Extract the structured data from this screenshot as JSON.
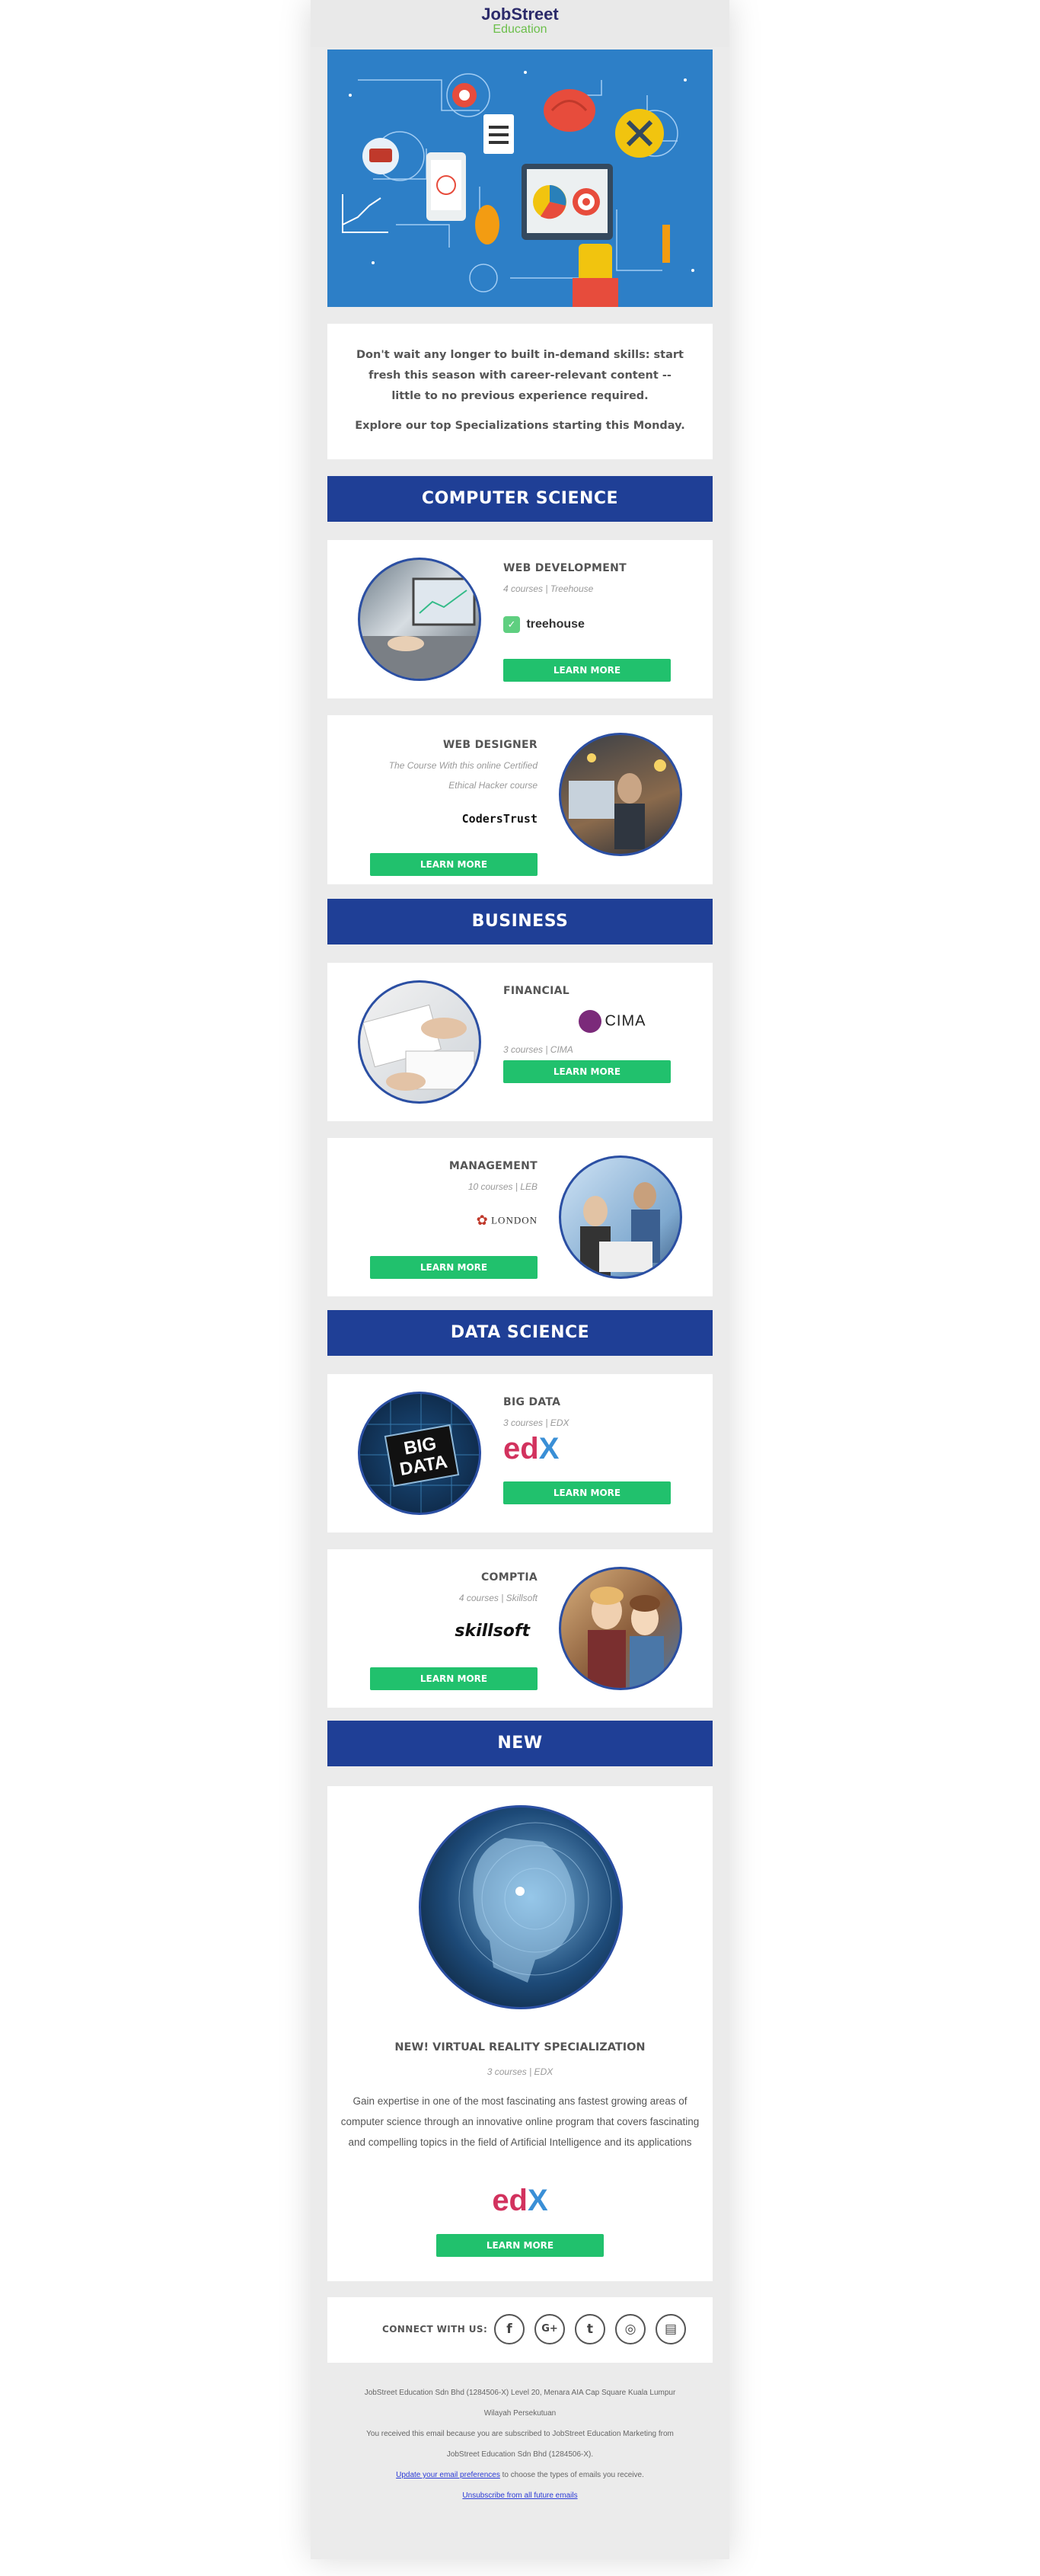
{
  "brand": {
    "logo_top": "JobStreet",
    "logo_bottom": "Education"
  },
  "intro": {
    "text": "Don't wait any longer to built in-demand skills: start fresh this season with career-relevant content -- little to no previous experience required.",
    "sub": "Explore our top Specializations starting this Monday."
  },
  "sections": {
    "cs": "COMPUTER SCIENCE",
    "business": "BUSINESS",
    "ds": "DATA SCIENCE",
    "new": "NEW"
  },
  "cards": {
    "webdev": {
      "title": "WEB DEVELOPMENT",
      "meta": "4 courses | Treehouse",
      "brand": "treehouse",
      "button": "LEARN MORE"
    },
    "webdesigner": {
      "title": "WEB DESIGNER",
      "meta_line1": "The Course With this online Certified",
      "meta_line2": "Ethical Hacker course",
      "brand": "CodersTrust",
      "button": "LEARN MORE"
    },
    "financial": {
      "title": "FINANCIAL",
      "meta": "3 courses | CIMA",
      "brand": "CIMA",
      "button": "LEARN MORE"
    },
    "management": {
      "title": "MANAGEMENT",
      "meta": "10 courses | LEB",
      "brand": "LONDON",
      "button": "LEARN MORE"
    },
    "bigdata": {
      "title": "BIG DATA",
      "meta": "3 courses | EDX",
      "brand_a": "ed",
      "brand_b": "X",
      "button": "LEARN MORE",
      "image_text_1": "BIG",
      "image_text_2": "DATA"
    },
    "comptia": {
      "title": "COMPTIA",
      "meta": "4 courses | Skillsoft",
      "brand": "skillsoft",
      "button": "LEARN MORE"
    }
  },
  "new_card": {
    "title": "NEW! VIRTUAL REALITY SPECIALIZATION",
    "meta": "3 courses | EDX",
    "description": "Gain expertise in one of the most fascinating ans fastest growing areas of computer science through an innovative online program that covers fascinating and compelling topics in the field of Artificial Intelligence and its applications",
    "brand_a": "ed",
    "brand_b": "X",
    "button": "LEARN MORE"
  },
  "footer": {
    "connect_label": "CONNECT WITH US:",
    "social": [
      {
        "name": "facebook-icon",
        "glyph": "f"
      },
      {
        "name": "google-plus-icon",
        "glyph": "G+"
      },
      {
        "name": "twitter-icon",
        "glyph": "t"
      },
      {
        "name": "instagram-icon",
        "glyph": "◎"
      },
      {
        "name": "newsletter-icon",
        "glyph": "▤"
      }
    ],
    "address": "JobStreet Education Sdn Bhd (1284506-X) Level 20, Menara AIA Cap Square Kuala Lumpur Wilayah Persekutuan",
    "received": "You received this email because you are subscribed to JobStreet Education Marketing from JobStreet Education Sdn Bhd (1284506-X).",
    "pref_link": "Update your email preferences",
    "pref_rest": " to choose the types of emails you receive.",
    "unsubscribe": "Unsubscribe from all future emails"
  },
  "colors": {
    "navy": "#1f3f96",
    "green": "#21c16d",
    "hero_blue": "#2d7fc7",
    "circle_border": "#2b4fa3"
  }
}
